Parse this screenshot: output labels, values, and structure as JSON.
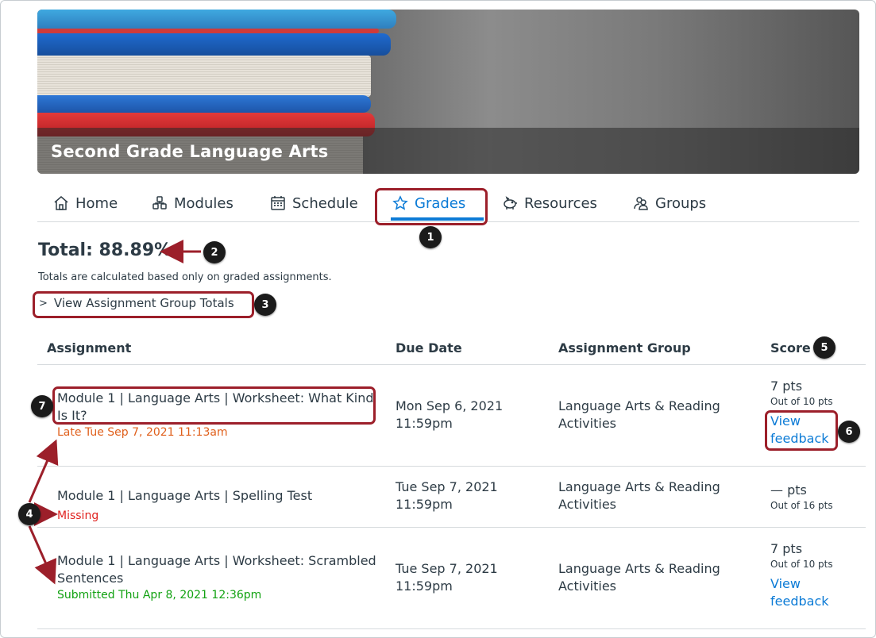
{
  "course": {
    "title": "Second Grade Language Arts"
  },
  "nav": {
    "items": [
      {
        "label": "Home",
        "icon": "home-icon"
      },
      {
        "label": "Modules",
        "icon": "modules-icon"
      },
      {
        "label": "Schedule",
        "icon": "calendar-icon"
      },
      {
        "label": "Grades",
        "icon": "star-icon",
        "active": true
      },
      {
        "label": "Resources",
        "icon": "piggy-bank-icon"
      },
      {
        "label": "Groups",
        "icon": "people-icon"
      }
    ]
  },
  "grades": {
    "total": "Total: 88.89%",
    "note": "Totals are calculated based only on graded assignments.",
    "group_totals_toggle": "View Assignment Group Totals"
  },
  "table": {
    "headers": [
      "Assignment",
      "Due Date",
      "Assignment Group",
      "Score"
    ],
    "rows": [
      {
        "title": "Module 1 | Language Arts | Worksheet: What Kind Is It?",
        "title_line1": "Module 1 | Language Arts | Worksheet: What Kind",
        "title_line2": "Is It?",
        "status": "Late Tue Sep 7, 2021 11:13am",
        "due_line1": "Mon Sep 6, 2021",
        "due_line2": "11:59pm",
        "group_line1": "Language Arts & Reading",
        "group_line2": "Activities",
        "score": "7 pts",
        "out_of": "Out of 10 pts",
        "feedback_line1": "View",
        "feedback_line2": "feedback"
      },
      {
        "title": "Module 1 | Language Arts | Spelling Test",
        "status": "Missing",
        "due_line1": "Tue Sep 7, 2021",
        "due_line2": "11:59pm",
        "group_line1": "Language Arts & Reading",
        "group_line2": "Activities",
        "score": "— pts",
        "out_of": "Out of 16 pts"
      },
      {
        "title": "Module 1 | Language Arts | Worksheet: Scrambled Sentences",
        "title_line1": "Module 1 | Language Arts | Worksheet: Scrambled",
        "title_line2": "Sentences",
        "status": "Submitted Thu Apr 8, 2021 12:36pm",
        "due_line1": "Tue Sep 7, 2021",
        "due_line2": "11:59pm",
        "group_line1": "Language Arts & Reading",
        "group_line2": "Activities",
        "score": "7 pts",
        "out_of": "Out of 10 pts",
        "feedback_line1": "View",
        "feedback_line2": "feedback"
      }
    ]
  },
  "callouts": [
    "1",
    "2",
    "3",
    "4",
    "5",
    "6",
    "7"
  ],
  "colors": {
    "accent": "#0c7bd6",
    "highlight": "#9c1f2a",
    "late": "#e0601c",
    "missing": "#e0221f",
    "submitted": "#12a212"
  }
}
